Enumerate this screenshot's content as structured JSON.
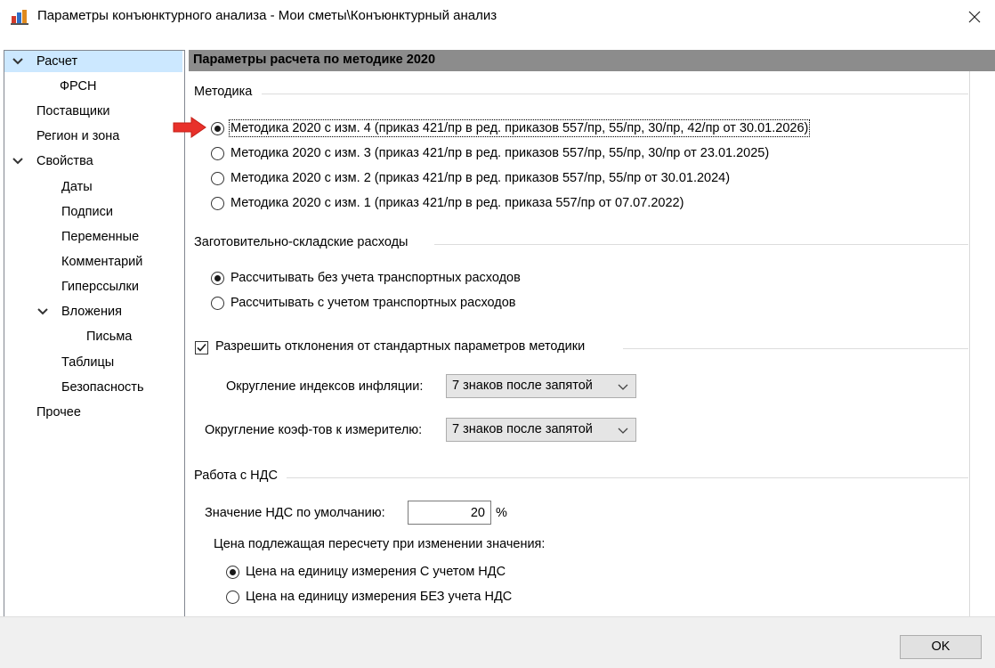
{
  "window": {
    "title": "Параметры конъюнктурного анализа - Мои сметы\\Конъюнктурный анализ",
    "app_icon": "app-chart-icon",
    "close_icon": "close-icon"
  },
  "sidebar": {
    "items": [
      {
        "label": "Расчет",
        "expanded": true,
        "selected": true
      },
      {
        "label": "ФРСН"
      },
      {
        "label": "Поставщики"
      },
      {
        "label": "Регион и зона"
      },
      {
        "label": "Свойства",
        "expanded": true
      },
      {
        "label": "Даты"
      },
      {
        "label": "Подписи"
      },
      {
        "label": "Переменные"
      },
      {
        "label": "Комментарий"
      },
      {
        "label": "Гиперссылки"
      },
      {
        "label": "Вложения",
        "expanded": true
      },
      {
        "label": "Письма"
      },
      {
        "label": "Таблицы"
      },
      {
        "label": "Безопасность"
      },
      {
        "label": "Прочее"
      }
    ]
  },
  "panel": {
    "header": "Параметры расчета по методике 2020",
    "method_group": {
      "label": "Методика",
      "options": [
        {
          "label": "Методика 2020 с изм. 4 (приказ 421/пр в ред. приказов 557/пр, 55/пр, 30/пр, 42/пр от 30.01.2026)",
          "checked": true
        },
        {
          "label": "Методика 2020 с изм. 3 (приказ 421/пр в ред. приказов 557/пр, 55/пр, 30/пр от 23.01.2025)",
          "checked": false
        },
        {
          "label": "Методика 2020 с изм. 2 (приказ 421/пр в ред. приказов 557/пр, 55/пр от 30.01.2024)",
          "checked": false
        },
        {
          "label": "Методика 2020 с изм. 1 (приказ 421/пр в ред. приказа 557/пр от 07.07.2022)",
          "checked": false
        }
      ]
    },
    "storage_group": {
      "label": "Заготовительно-складские расходы",
      "options": [
        {
          "label": "Рассчитывать без учета транспортных расходов",
          "checked": true
        },
        {
          "label": "Рассчитывать с учетом транспортных расходов",
          "checked": false
        }
      ]
    },
    "deviations": {
      "label": "Разрешить отклонения от стандартных параметров методики",
      "checked": true,
      "inflation_rounding": {
        "label": "Округление индексов инфляции:",
        "value": "7 знаков после запятой"
      },
      "coef_rounding": {
        "label": "Округление коэф-тов к измерителю:",
        "value": "7 знаков после запятой"
      }
    },
    "vat_group": {
      "label": "Работа с НДС",
      "default_label": "Значение НДС по умолчанию:",
      "default_value": "20",
      "unit": "%",
      "recalc_label": "Цена подлежащая пересчету при изменении значения:",
      "options": [
        {
          "label": "Цена на единицу измерения С учетом НДС",
          "checked": true
        },
        {
          "label": "Цена на единицу измерения БЕЗ учета НДС",
          "checked": false
        }
      ]
    }
  },
  "footer": {
    "ok_label": "OK"
  },
  "colors": {
    "accent_arrow": "#e8312b",
    "selection": "#cce8ff",
    "header_bg": "#8c8c8c"
  }
}
